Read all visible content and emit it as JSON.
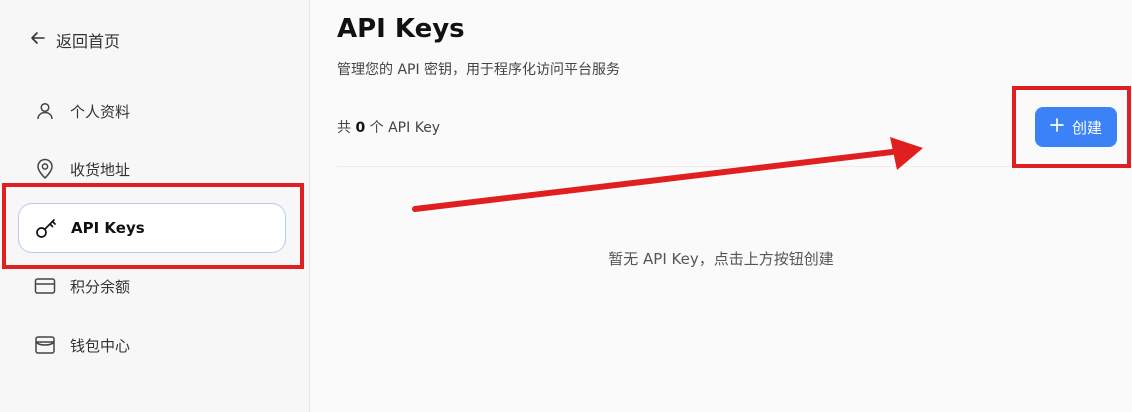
{
  "sidebar": {
    "back_label": "返回首页",
    "items": [
      {
        "label": "个人资料",
        "icon": "user-icon",
        "active": false
      },
      {
        "label": "收货地址",
        "icon": "location-pin-icon",
        "active": false
      },
      {
        "label": "API Keys",
        "icon": "key-icon",
        "active": true
      },
      {
        "label": "积分余额",
        "icon": "credit-card-icon",
        "active": false
      },
      {
        "label": "钱包中心",
        "icon": "wallet-icon",
        "active": false
      }
    ]
  },
  "main": {
    "title": "API Keys",
    "subtitle": "管理您的 API 密钥，用于程序化访问平台服务",
    "count_prefix": "共",
    "count_value": "0",
    "count_suffix": "个 API Key",
    "create_button": {
      "icon": "plus-icon",
      "label": "创建"
    },
    "empty_text": "暂无 API Key，点击上方按钮创建"
  },
  "colors": {
    "accent": "#3b82f6",
    "annotation": "#e02020",
    "active_border": "#b8c8f2"
  }
}
